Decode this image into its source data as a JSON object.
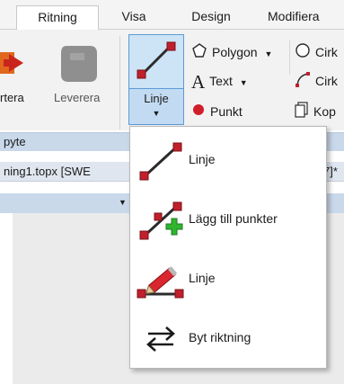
{
  "tabs": [
    {
      "label": "Ritning",
      "active": true
    },
    {
      "label": "Visa",
      "active": false
    },
    {
      "label": "Design",
      "active": false
    },
    {
      "label": "Modifiera",
      "active": false
    }
  ],
  "ribbon": {
    "big_buttons": {
      "left_partial": "rtera",
      "leverera": "Leverera",
      "linje": "Linje"
    },
    "small_commands": {
      "polygon": "Polygon",
      "text": "Text",
      "punkt": "Punkt",
      "cirkel1": "Cirk",
      "cirkel2": "Cirk",
      "kopiera": "Kop"
    },
    "group_footer_label": "pyte"
  },
  "document": {
    "title": "ning1.topx [SWE",
    "title_suffix": "7]*"
  },
  "menu": {
    "items": [
      {
        "label": "Linje",
        "icon": "line-icon"
      },
      {
        "label": "Lägg till punkter",
        "icon": "add-points-icon"
      },
      {
        "label": "Linje",
        "icon": "pencil-line-icon"
      },
      {
        "label": "Byt riktning",
        "icon": "swap-direction-icon"
      }
    ]
  },
  "colors": {
    "accent": "#5b9bd5",
    "point_red": "#c0202c",
    "plus_green": "#2fb52f",
    "line_dark": "#2b2b2b"
  }
}
